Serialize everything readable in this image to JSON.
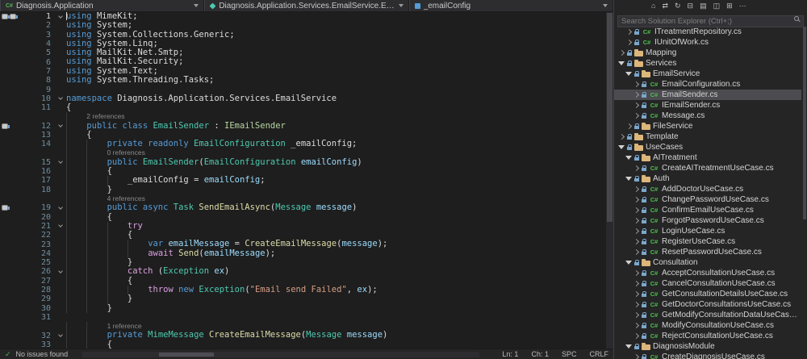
{
  "icons": {
    "csharp": "C#"
  },
  "navbar": {
    "project": "Diagnosis.Application",
    "type": "Diagnosis.Application.Services.EmailService.EmailSender",
    "member": "_emailConfig"
  },
  "editor": {
    "rows": [
      {
        "k": "c",
        "n": 1,
        "i": 0,
        "f": 1,
        "caret": true,
        "m": [
          "margin-glyph-icon",
          "margin-glyph-icon"
        ],
        "t": [
          [
            "kw",
            "using "
          ],
          [
            "id",
            "MimeKit"
          ],
          [
            "pl",
            ";"
          ]
        ]
      },
      {
        "k": "c",
        "n": 2,
        "i": 0,
        "t": [
          [
            "kw",
            "using "
          ],
          [
            "id",
            "System"
          ],
          [
            "pl",
            ";"
          ]
        ]
      },
      {
        "k": "c",
        "n": 3,
        "i": 0,
        "t": [
          [
            "kw",
            "using "
          ],
          [
            "id",
            "System.Collections.Generic"
          ],
          [
            "pl",
            ";"
          ]
        ]
      },
      {
        "k": "c",
        "n": 4,
        "i": 0,
        "t": [
          [
            "kw",
            "using "
          ],
          [
            "id",
            "System.Linq"
          ],
          [
            "pl",
            ";"
          ]
        ]
      },
      {
        "k": "c",
        "n": 5,
        "i": 0,
        "t": [
          [
            "kw",
            "using "
          ],
          [
            "id",
            "MailKit.Net.Smtp"
          ],
          [
            "pl",
            ";"
          ]
        ]
      },
      {
        "k": "c",
        "n": 6,
        "i": 0,
        "t": [
          [
            "kw",
            "using "
          ],
          [
            "id",
            "MailKit.Security"
          ],
          [
            "pl",
            ";"
          ]
        ]
      },
      {
        "k": "c",
        "n": 7,
        "i": 0,
        "t": [
          [
            "kw",
            "using "
          ],
          [
            "id",
            "System.Text"
          ],
          [
            "pl",
            ";"
          ]
        ]
      },
      {
        "k": "c",
        "n": 8,
        "i": 0,
        "t": [
          [
            "kw",
            "using "
          ],
          [
            "id",
            "System.Threading.Tasks"
          ],
          [
            "pl",
            ";"
          ]
        ]
      },
      {
        "k": "c",
        "n": 9,
        "i": 0,
        "t": []
      },
      {
        "k": "c",
        "n": 10,
        "i": 0,
        "f": 1,
        "t": [
          [
            "kw",
            "namespace "
          ],
          [
            "id",
            "Diagnosis.Application.Services.EmailService"
          ]
        ]
      },
      {
        "k": "c",
        "n": 11,
        "i": 0,
        "t": [
          [
            "pl",
            "{"
          ]
        ]
      },
      {
        "k": "l",
        "i": 1,
        "txt": "2 references"
      },
      {
        "k": "c",
        "n": 12,
        "i": 1,
        "f": 1,
        "m": [
          "margin-glyph-icon"
        ],
        "t": [
          [
            "kw",
            "public class "
          ],
          [
            "ty",
            "EmailSender"
          ],
          [
            "pl",
            " : "
          ],
          [
            "if",
            "IEmailSender"
          ]
        ]
      },
      {
        "k": "c",
        "n": 13,
        "i": 1,
        "t": [
          [
            "pl",
            "{"
          ]
        ]
      },
      {
        "k": "c",
        "n": 14,
        "i": 2,
        "t": [
          [
            "kw",
            "private readonly "
          ],
          [
            "ty",
            "EmailConfiguration"
          ],
          [
            "id",
            " _emailConfig"
          ],
          [
            "pl",
            ";"
          ]
        ]
      },
      {
        "k": "l",
        "i": 2,
        "txt": "0 references"
      },
      {
        "k": "c",
        "n": 15,
        "i": 2,
        "f": 1,
        "t": [
          [
            "kw",
            "public "
          ],
          [
            "ty",
            "EmailSender"
          ],
          [
            "pl",
            "("
          ],
          [
            "ty",
            "EmailConfiguration"
          ],
          [
            "pr",
            " emailConfig"
          ],
          [
            "pl",
            ")"
          ]
        ]
      },
      {
        "k": "c",
        "n": 16,
        "i": 2,
        "t": [
          [
            "pl",
            "{"
          ]
        ]
      },
      {
        "k": "c",
        "n": 17,
        "i": 3,
        "t": [
          [
            "id",
            "_emailConfig"
          ],
          [
            "pl",
            " = "
          ],
          [
            "pr",
            "emailConfig"
          ],
          [
            "pl",
            ";"
          ]
        ]
      },
      {
        "k": "c",
        "n": 18,
        "i": 2,
        "t": [
          [
            "pl",
            "}"
          ]
        ]
      },
      {
        "k": "l",
        "i": 2,
        "txt": "4 references"
      },
      {
        "k": "c",
        "n": 19,
        "i": 2,
        "f": 1,
        "m": [
          "margin-glyph-icon"
        ],
        "t": [
          [
            "kw",
            "public async "
          ],
          [
            "ty",
            "Task"
          ],
          [
            "pl",
            " "
          ],
          [
            "m",
            "SendEmailAsync"
          ],
          [
            "pl",
            "("
          ],
          [
            "ty",
            "Message"
          ],
          [
            "pr",
            " message"
          ],
          [
            "pl",
            ")"
          ]
        ]
      },
      {
        "k": "c",
        "n": 20,
        "i": 2,
        "t": [
          [
            "pl",
            "{"
          ]
        ]
      },
      {
        "k": "c",
        "n": 21,
        "i": 3,
        "f": 1,
        "t": [
          [
            "ct",
            "try"
          ]
        ]
      },
      {
        "k": "c",
        "n": 22,
        "i": 3,
        "t": [
          [
            "pl",
            "{"
          ]
        ]
      },
      {
        "k": "c",
        "n": 23,
        "i": 4,
        "t": [
          [
            "kw",
            "var"
          ],
          [
            "pr",
            " emailMessage"
          ],
          [
            "pl",
            " = "
          ],
          [
            "m",
            "CreateEmailMessage"
          ],
          [
            "pl",
            "("
          ],
          [
            "pr",
            "message"
          ],
          [
            "pl",
            ");"
          ]
        ]
      },
      {
        "k": "c",
        "n": 24,
        "i": 4,
        "t": [
          [
            "ct",
            "await "
          ],
          [
            "m",
            "Send"
          ],
          [
            "pl",
            "("
          ],
          [
            "pr",
            "emailMessage"
          ],
          [
            "pl",
            ");"
          ]
        ]
      },
      {
        "k": "c",
        "n": 25,
        "i": 3,
        "t": [
          [
            "pl",
            "}"
          ]
        ]
      },
      {
        "k": "c",
        "n": 26,
        "i": 3,
        "f": 1,
        "t": [
          [
            "ct",
            "catch"
          ],
          [
            "pl",
            " ("
          ],
          [
            "ty",
            "Exception"
          ],
          [
            "pr",
            " ex"
          ],
          [
            "pl",
            ")"
          ]
        ]
      },
      {
        "k": "c",
        "n": 27,
        "i": 3,
        "t": [
          [
            "pl",
            "{"
          ]
        ]
      },
      {
        "k": "c",
        "n": 28,
        "i": 4,
        "t": [
          [
            "ct",
            "throw "
          ],
          [
            "kw",
            "new "
          ],
          [
            "ty",
            "Exception"
          ],
          [
            "pl",
            "("
          ],
          [
            "st",
            "\"Email send Failed\""
          ],
          [
            "pl",
            ", "
          ],
          [
            "pr",
            "ex"
          ],
          [
            "pl",
            ");"
          ]
        ]
      },
      {
        "k": "c",
        "n": 29,
        "i": 3,
        "t": [
          [
            "pl",
            "}"
          ]
        ]
      },
      {
        "k": "c",
        "n": 30,
        "i": 2,
        "t": [
          [
            "pl",
            "}"
          ]
        ]
      },
      {
        "k": "c",
        "n": 31,
        "i": 0,
        "t": []
      },
      {
        "k": "l",
        "i": 2,
        "txt": "1 reference"
      },
      {
        "k": "c",
        "n": 32,
        "i": 2,
        "f": 1,
        "t": [
          [
            "kw",
            "private "
          ],
          [
            "ty",
            "MimeMessage"
          ],
          [
            "pl",
            " "
          ],
          [
            "m",
            "CreateEmailMessage"
          ],
          [
            "pl",
            "("
          ],
          [
            "ty",
            "Message"
          ],
          [
            "pr",
            " message"
          ],
          [
            "pl",
            ")"
          ]
        ]
      },
      {
        "k": "c",
        "n": 33,
        "i": 2,
        "t": [
          [
            "pl",
            "{"
          ]
        ]
      }
    ]
  },
  "solution_explorer": {
    "search_placeholder": "Search Solution Explorer (Ctrl+;)",
    "toolbar": [
      {
        "name": "home-icon",
        "glyph": "⌂"
      },
      {
        "name": "sync-active-document-icon",
        "glyph": "⇄"
      },
      {
        "name": "refresh-icon",
        "glyph": "↻"
      },
      {
        "name": "collapse-all-icon",
        "glyph": "⊟"
      },
      {
        "name": "show-all-files-icon",
        "glyph": "▤"
      },
      {
        "name": "properties-icon",
        "glyph": "◫"
      },
      {
        "name": "preview-selected-items-icon",
        "glyph": "⊞"
      },
      {
        "name": "more-options-icon",
        "glyph": "⋯"
      }
    ],
    "items": [
      {
        "label": "ITreatmentRepository.cs",
        "d": 3,
        "icon": "cs",
        "chev": "col"
      },
      {
        "label": "IUnitOfWork.cs",
        "d": 3,
        "icon": "cs",
        "chev": "col"
      },
      {
        "label": "Mapping",
        "d": 2,
        "icon": "folder",
        "chev": "col"
      },
      {
        "label": "Services",
        "d": 2,
        "icon": "folder",
        "chev": "exp"
      },
      {
        "label": "EmailService",
        "d": 3,
        "icon": "folder",
        "chev": "exp"
      },
      {
        "label": "EmailConfiguration.cs",
        "d": 4,
        "icon": "cs",
        "chev": "col"
      },
      {
        "label": "EmailSender.cs",
        "d": 4,
        "icon": "cs",
        "chev": "col",
        "selected": true
      },
      {
        "label": "IEmailSender.cs",
        "d": 4,
        "icon": "cs",
        "chev": "col"
      },
      {
        "label": "Message.cs",
        "d": 4,
        "icon": "cs",
        "chev": "col"
      },
      {
        "label": "FileService",
        "d": 3,
        "icon": "folder",
        "chev": "col"
      },
      {
        "label": "Template",
        "d": 2,
        "icon": "folder",
        "chev": "col"
      },
      {
        "label": "UseCases",
        "d": 2,
        "icon": "folder",
        "chev": "exp"
      },
      {
        "label": "AITreatment",
        "d": 3,
        "icon": "folder",
        "chev": "exp"
      },
      {
        "label": "CreateAITreatmentUseCase.cs",
        "d": 4,
        "icon": "cs",
        "chev": "col"
      },
      {
        "label": "Auth",
        "d": 3,
        "icon": "folder",
        "chev": "exp"
      },
      {
        "label": "AddDoctorUseCase.cs",
        "d": 4,
        "icon": "cs",
        "chev": "col"
      },
      {
        "label": "ChangePasswordUseCase.cs",
        "d": 4,
        "icon": "cs",
        "chev": "col"
      },
      {
        "label": "ConfirmEmailUseCase.cs",
        "d": 4,
        "icon": "cs",
        "chev": "col"
      },
      {
        "label": "ForgotPasswordUseCase.cs",
        "d": 4,
        "icon": "cs",
        "chev": "col"
      },
      {
        "label": "LoginUseCase.cs",
        "d": 4,
        "icon": "cs",
        "chev": "col"
      },
      {
        "label": "RegisterUseCase.cs",
        "d": 4,
        "icon": "cs",
        "chev": "col"
      },
      {
        "label": "ResetPasswordUseCase.cs",
        "d": 4,
        "icon": "cs",
        "chev": "col"
      },
      {
        "label": "Consultation",
        "d": 3,
        "icon": "folder",
        "chev": "exp"
      },
      {
        "label": "AcceptConsultationUseCase.cs",
        "d": 4,
        "icon": "cs",
        "chev": "col"
      },
      {
        "label": "CancelConsultationUseCase.cs",
        "d": 4,
        "icon": "cs",
        "chev": "col"
      },
      {
        "label": "GetConsultationDetailsUseCase.cs",
        "d": 4,
        "icon": "cs",
        "chev": "col"
      },
      {
        "label": "GetDoctorConsultationsUseCase.cs",
        "d": 4,
        "icon": "cs",
        "chev": "col"
      },
      {
        "label": "GetModifyConsultationDataUseCase.cs",
        "d": 4,
        "icon": "cs",
        "chev": "col"
      },
      {
        "label": "ModifyConsultationUseCase.cs",
        "d": 4,
        "icon": "cs",
        "chev": "col"
      },
      {
        "label": "RejectConsultationUseCase.cs",
        "d": 4,
        "icon": "cs",
        "chev": "col"
      },
      {
        "label": "DiagnosisModule",
        "d": 3,
        "icon": "folder",
        "chev": "exp"
      },
      {
        "label": "CreateDiagnosisUseCase.cs",
        "d": 4,
        "icon": "cs",
        "chev": "col"
      }
    ]
  },
  "status": {
    "issues": "No issues found",
    "ln": "Ln: 1",
    "ch": "Ch: 1",
    "encoding": "SPC",
    "line_ending": "CRLF"
  },
  "colors": {
    "editor_bg": "#1e1e1e",
    "panel_bg": "#252526",
    "selection": "#4b4b50",
    "keyword": "#569cd6",
    "control_keyword": "#d8a0df",
    "type": "#4ec9b0",
    "interface": "#b8d7a3",
    "method": "#dcdcaa",
    "parameter": "#9cdcfe",
    "string": "#d69d85",
    "health_ok": "#54b054",
    "folder_icon": "#dcb67a",
    "csharp_icon": "#4cc04c"
  }
}
